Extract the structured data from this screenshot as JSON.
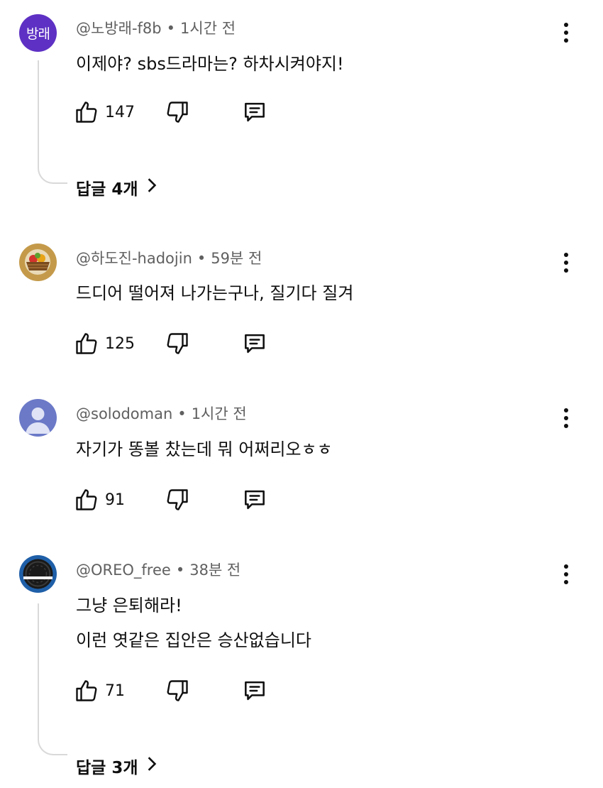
{
  "comments": [
    {
      "avatar_text": "방래",
      "author": "@노방래-f8b",
      "time": "1시간 전",
      "lines": [
        "이제야? sbs드라마는? 하차시켜야지!"
      ],
      "likes": "147",
      "replies": "답글 4개"
    },
    {
      "author": "@하도진-hadojin",
      "time": "59분 전",
      "lines": [
        "드디어 떨어져 나가는구나, 질기다 질겨"
      ],
      "likes": "125"
    },
    {
      "author": "@solodoman",
      "time": "1시간 전",
      "lines": [
        "자기가 똥볼 찼는데 뭐 어쩌리오ㅎㅎ"
      ],
      "likes": "91"
    },
    {
      "author": "@OREO_free",
      "time": "38분 전",
      "lines": [
        "그냥 은퇴해라!",
        "이런 엿같은 집안은 승산없습니다"
      ],
      "likes": "71",
      "replies": "답글 3개"
    }
  ],
  "separator": "•",
  "colors": {
    "avatar_purple": "#5e31c4",
    "meta_gray": "#606060",
    "thread_line": "#d9d9d9"
  }
}
